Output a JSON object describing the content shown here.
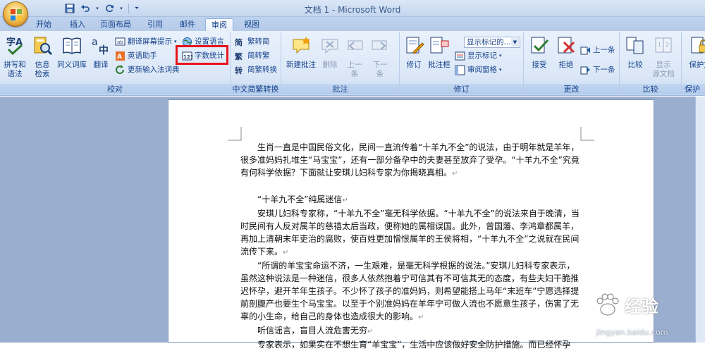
{
  "window": {
    "title": "文档 1 - Microsoft Word"
  },
  "qat": {
    "save_icon": "save-icon",
    "undo_icon": "undo-icon",
    "redo_icon": "redo-icon"
  },
  "tabs": [
    {
      "label": "开始"
    },
    {
      "label": "插入"
    },
    {
      "label": "页面布局"
    },
    {
      "label": "引用"
    },
    {
      "label": "邮件"
    },
    {
      "label": "审阅"
    },
    {
      "label": "视图"
    }
  ],
  "ribbon": {
    "proofing": {
      "label": "校对",
      "spelling": "拼写和\n语法",
      "spelling_l1": "拼写和",
      "spelling_l2": "语法",
      "research_l1": "信息",
      "research_l2": "检索",
      "thesaurus": "同义词库",
      "translate": "翻译",
      "translate_tip": "翻译屏幕提示",
      "english_assistant": "英语助手",
      "update_ime": "更新输入法词典",
      "set_language": "设置语言",
      "word_count": "字数统计"
    },
    "chinese_conversion": {
      "label": "中文简繁转换",
      "to_simplified": "繁转简",
      "to_traditional": "简转繁",
      "convert": "简繁转换"
    },
    "comments": {
      "label": "批注",
      "new": "新建批注",
      "delete": "删除",
      "prev_l1": "上一",
      "prev_l2": "条",
      "next_l1": "下一",
      "next_l2": "条"
    },
    "tracking": {
      "label": "修订",
      "track": "修订",
      "balloons": "批注框",
      "display_select": "显示标记的...",
      "show_markup": "显示标记",
      "review_pane": "审阅窗格"
    },
    "changes": {
      "label": "更改",
      "accept": "接受",
      "reject": "拒绝",
      "previous": "上一条",
      "next": "下一条"
    },
    "compare": {
      "label": "比较",
      "compare": "比较",
      "show_source_l1": "显示",
      "show_source_l2": "源文档"
    },
    "protect": {
      "label": "保护",
      "protect_doc": "保护文"
    }
  },
  "document": {
    "paragraphs": [
      {
        "text": "生肖一直是中国民俗文化，民间一直流传着“十羊九不全”的说法，由于明年就是羊年，很多准妈妈扎堆生“马宝宝”，还有一部分备孕中的夫妻甚至放弃了受孕。“十羊九不全”究竟有何科学依据？下面就让安琪儿妇科专家为你揭晓真相。"
      },
      {
        "text": "“十羊九不全”纯属迷信"
      },
      {
        "text": "安琪儿妇科专家称，“十羊九不全”毫无科学依据。“十羊九不全”的说法来自于晚清，当时民间有人反对属羊的慈禧太后当政，便称她的属相误国。此外，曾国藩、李鸿章都属羊，再加上清朝末年吏治的腐败，使百姓更加憎恨属羊的王侯将相，“十羊九不全”之说就在民间流传下来。"
      },
      {
        "text": "“所谓的羊宝宝命运不济，一生艰难，是毫无科学根据的说法。”安琪儿妇科专家表示，虽然这种说法是一种迷信，很多人依然抱着宁可信其有不可信其无的态度，有些夫妇干脆推迟怀孕，避开羊年生孩子。不少怀了孩子的准妈妈，则希望能搭上马年“末班车”宁愿选择提前剖腹产也要生个马宝宝。以至于个别准妈妈在羊年宁可做人流也不愿意生孩子，伤害了无辜的小生命，给自己的身体也造成很大的影响。"
      },
      {
        "text": "听信谣言，盲目人流危害无穷"
      },
      {
        "text": "专家表示，如果实在不想生育“羊宝宝”，生活中应该做好安全防护措施。而已经怀孕"
      }
    ]
  },
  "watermark": {
    "brand": "经验",
    "url": "jingyan.baidu.com"
  },
  "colors": {
    "highlight": "#e8141b",
    "ribbon_text": "#15428b"
  }
}
